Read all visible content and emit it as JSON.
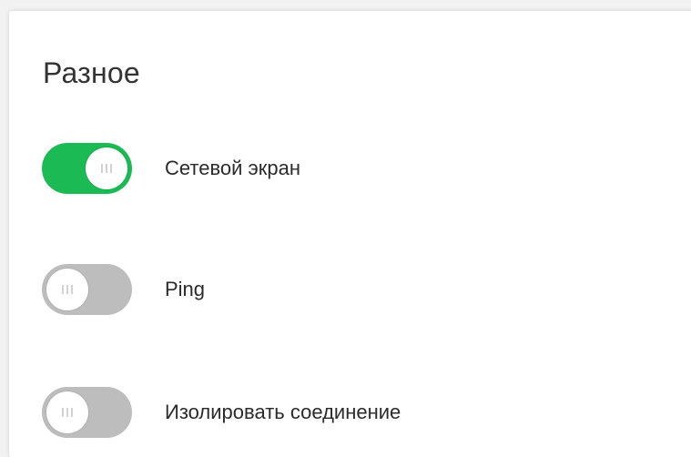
{
  "section": {
    "title": "Разное"
  },
  "colors": {
    "toggle_on": "#1bba55",
    "toggle_off": "#bdbdbd",
    "card_background": "#ffffff",
    "page_background": "#f2f2f2"
  },
  "toggles": [
    {
      "label": "Сетевой экран",
      "state": "on",
      "icon": "toggle-switch"
    },
    {
      "label": "Ping",
      "state": "off",
      "icon": "toggle-switch"
    },
    {
      "label": "Изолировать соединение",
      "state": "off",
      "icon": "toggle-switch"
    }
  ]
}
